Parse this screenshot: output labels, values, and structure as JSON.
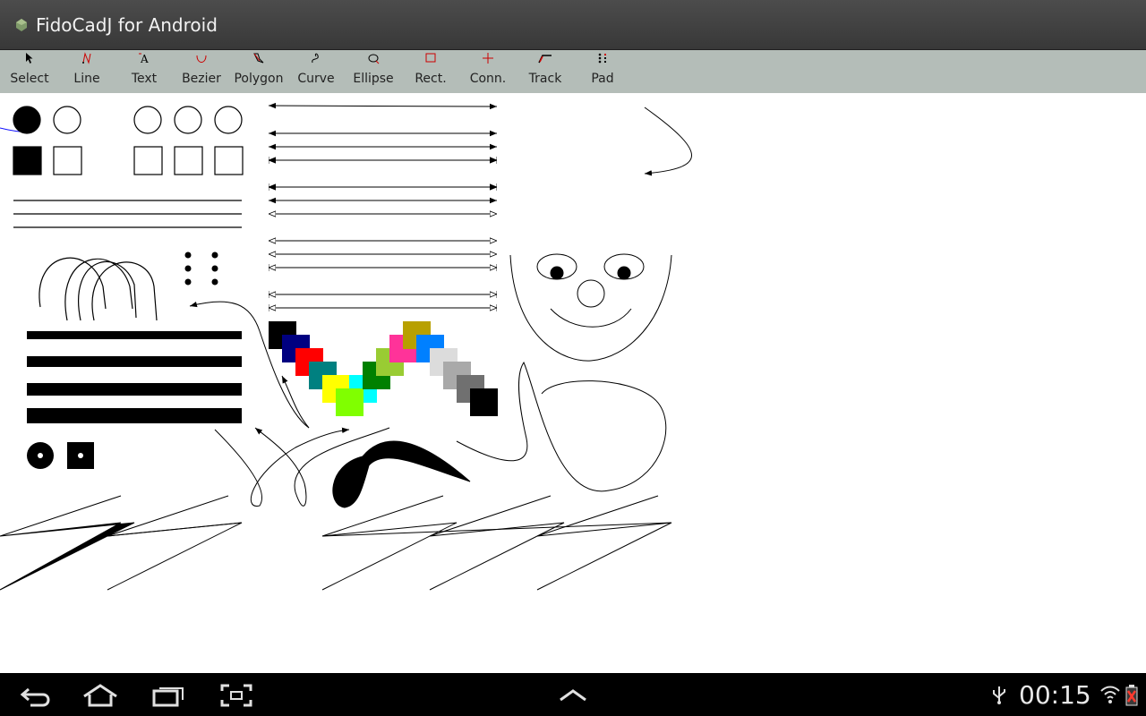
{
  "app": {
    "title": "FidoCadJ for Android",
    "icon": "android-app-icon"
  },
  "toolbar": {
    "tools": [
      {
        "label": "Select",
        "icon": "cursor-arrow-icon"
      },
      {
        "label": "Line",
        "icon": "line-tool-icon"
      },
      {
        "label": "Text",
        "icon": "text-tool-icon"
      },
      {
        "label": "Bezier",
        "icon": "bezier-tool-icon"
      },
      {
        "label": "Polygon",
        "icon": "polygon-tool-icon"
      },
      {
        "label": "Curve",
        "icon": "curve-tool-icon"
      },
      {
        "label": "Ellipse",
        "icon": "ellipse-tool-icon"
      },
      {
        "label": "Rect.",
        "icon": "rectangle-tool-icon"
      },
      {
        "label": "Conn.",
        "icon": "connection-tool-icon"
      },
      {
        "label": "Track",
        "icon": "track-tool-icon"
      },
      {
        "label": "Pad",
        "icon": "pad-tool-icon"
      }
    ]
  },
  "statusbar": {
    "time": "00:15",
    "icons": [
      "usb-icon",
      "wifi-icon",
      "battery-icon"
    ]
  },
  "navbar": {
    "buttons": [
      "back-icon",
      "home-icon",
      "recent-apps-icon",
      "screenshot-icon",
      "up-chevron-icon"
    ]
  },
  "colors": {
    "toolbar_bg": "#b4bdb8",
    "titlebar_bg": "#3f3f3f",
    "swatches": [
      "#000000",
      "#000080",
      "#ff0000",
      "#008080",
      "#ffff00",
      "#00ffff",
      "#80ff00",
      "#008000",
      "#99cc33",
      "#ff3399",
      "#b8a000",
      "#0080ff",
      "#dcdcdc",
      "#a9a9a9",
      "#707070",
      "#000000"
    ]
  }
}
